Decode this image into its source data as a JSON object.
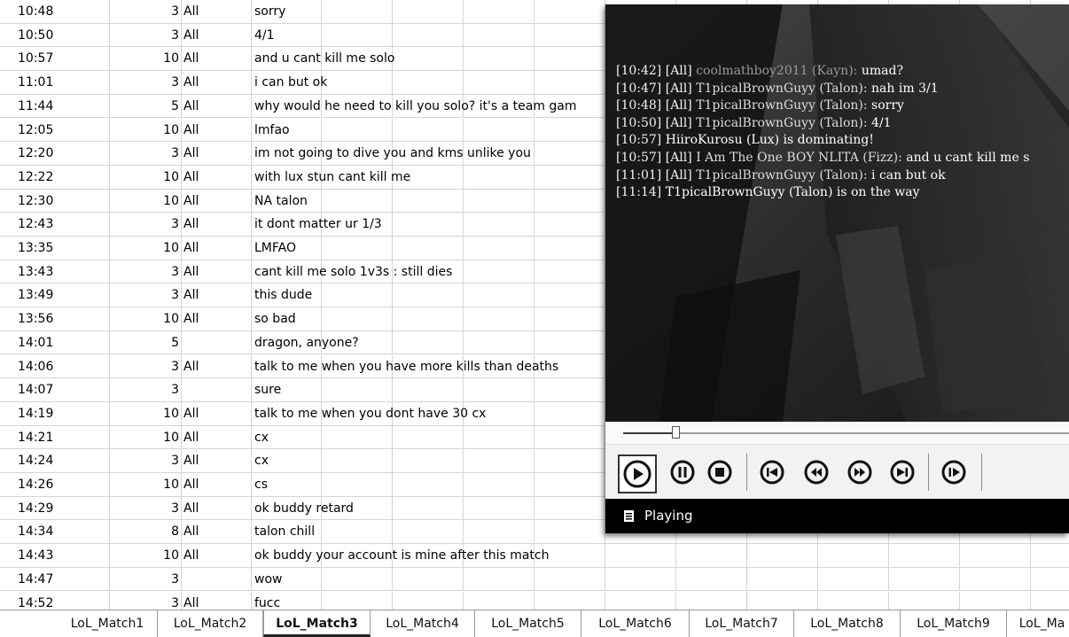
{
  "sheet": {
    "rows": [
      [
        "10:48",
        "3",
        "All",
        "sorry"
      ],
      [
        "10:50",
        "3",
        "All",
        "4/1"
      ],
      [
        "10:57",
        "10",
        "All",
        "and u cant kill me solo"
      ],
      [
        "11:01",
        "3",
        "All",
        "i can but ok"
      ],
      [
        "11:44",
        "5",
        "All",
        "why would he need to kill you solo? it's a team gam"
      ],
      [
        "12:05",
        "10",
        "All",
        "lmfao"
      ],
      [
        "12:20",
        "3",
        "All",
        "im not going to dive you and kms unlike you"
      ],
      [
        "12:22",
        "10",
        "All",
        "with lux stun cant kill me"
      ],
      [
        "12:30",
        "10",
        "All",
        "NA talon"
      ],
      [
        "12:43",
        "3",
        "All",
        "it dont matter ur 1/3"
      ],
      [
        "13:35",
        "10",
        "All",
        "LMFAO"
      ],
      [
        "13:43",
        "3",
        "All",
        "cant kill me solo 1v3s : still dies"
      ],
      [
        "13:49",
        "3",
        "All",
        "this dude"
      ],
      [
        "13:56",
        "10",
        "All",
        "so bad"
      ],
      [
        "14:01",
        "5",
        "",
        "dragon, anyone?"
      ],
      [
        "14:06",
        "3",
        "All",
        "talk to me when you have more kills than deaths"
      ],
      [
        "14:07",
        "3",
        "",
        "sure"
      ],
      [
        "14:19",
        "10",
        "All",
        "talk to me when you dont have 30 cx"
      ],
      [
        "14:21",
        "10",
        "All",
        "cx"
      ],
      [
        "14:24",
        "3",
        "All",
        "cx"
      ],
      [
        "14:26",
        "10",
        "All",
        "cs"
      ],
      [
        "14:29",
        "3",
        "All",
        "ok buddy retard"
      ],
      [
        "14:34",
        "8",
        "All",
        "talon chill"
      ],
      [
        "14:43",
        "10",
        "All",
        "ok buddy your account is mine after this match"
      ],
      [
        "14:47",
        "3",
        "",
        "wow"
      ],
      [
        "14:52",
        "3",
        "All",
        "fucc"
      ]
    ]
  },
  "tabs": [
    {
      "label": "LoL_Match1",
      "active": false
    },
    {
      "label": "LoL_Match2",
      "active": false
    },
    {
      "label": "LoL_Match3",
      "active": true
    },
    {
      "label": "LoL_Match4",
      "active": false
    },
    {
      "label": "LoL_Match5",
      "active": false
    },
    {
      "label": "LoL_Match6",
      "active": false
    },
    {
      "label": "LoL_Match7",
      "active": false
    },
    {
      "label": "LoL_Match8",
      "active": false
    },
    {
      "label": "LoL_Match9",
      "active": false
    },
    {
      "label": "LoL_Ma",
      "active": false
    }
  ],
  "player": {
    "chat": [
      {
        "time": "[10:42]",
        "channel": "[All]",
        "name": "coolmathboy2011 (Kayn):",
        "msg": "umad?",
        "faint": true
      },
      {
        "time": "[10:47]",
        "channel": "[All]",
        "name": "T1picalBrownGuyy (Talon):",
        "msg": "nah im 3/1",
        "faint": false
      },
      {
        "time": "[10:48]",
        "channel": "[All]",
        "name": "T1picalBrownGuyy (Talon):",
        "msg": "sorry",
        "faint": false
      },
      {
        "time": "[10:50]",
        "channel": "[All]",
        "name": "T1picalBrownGuyy (Talon):",
        "msg": "4/1",
        "faint": false
      },
      {
        "time": "[10:57]",
        "channel": "",
        "name": "",
        "msg": "HiiroKurosu (Lux) is dominating!",
        "faint": false
      },
      {
        "time": "[10:57]",
        "channel": "[All]",
        "name": "I Am The One BOY NLITA (Fizz):",
        "msg": "and u cant kill me s",
        "faint": false
      },
      {
        "time": "[11:01]",
        "channel": "[All]",
        "name": "T1picalBrownGuyy (Talon):",
        "msg": "i can but ok",
        "faint": false
      },
      {
        "time": "[11:14]",
        "channel": "",
        "name": "",
        "msg": "T1picalBrownGuyy (Talon) is on the way",
        "faint": false
      }
    ],
    "seek_progress": 0.12,
    "status": "Playing",
    "icons": {
      "play": "play-icon",
      "pause": "pause-icon",
      "stop": "stop-icon",
      "skip_back": "skip-back-icon",
      "rewind": "rewind-icon",
      "fast_forward": "fast-forward-icon",
      "skip_forward": "skip-forward-icon",
      "frame_step": "frame-step-icon",
      "status": "media-file-icon"
    }
  }
}
